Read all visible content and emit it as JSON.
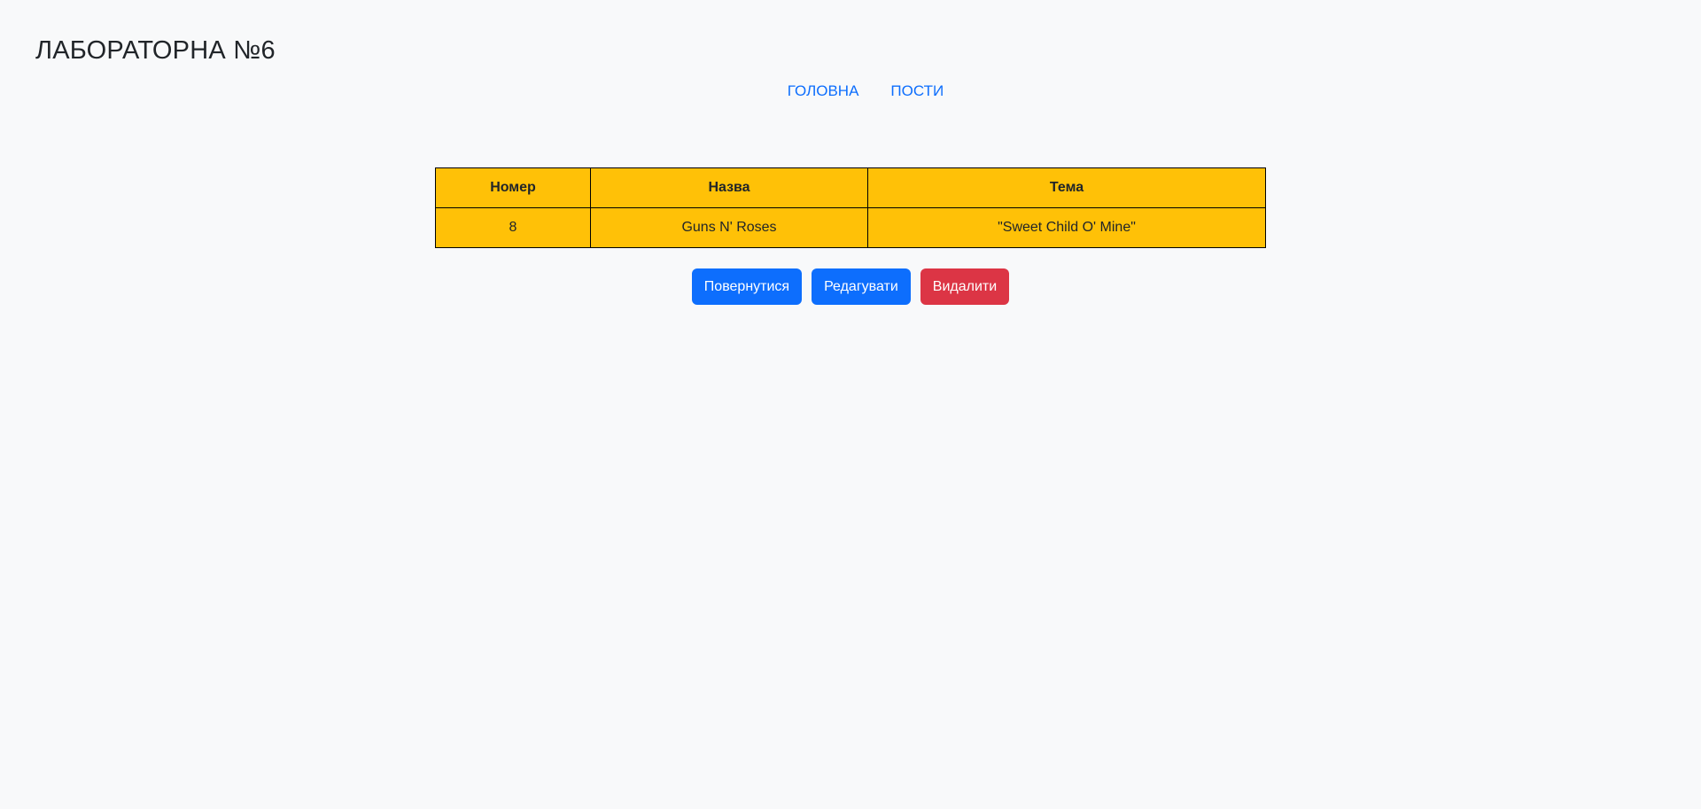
{
  "header": {
    "title": "ЛАБОРАТОРНА №6"
  },
  "nav": {
    "items": [
      {
        "label": "ГОЛОВНА"
      },
      {
        "label": "ПОСТИ"
      }
    ]
  },
  "table": {
    "columns": [
      "Номер",
      "Назва",
      "Тема"
    ],
    "rows": [
      [
        "8",
        "Guns N' Roses",
        "\"Sweet Child O' Mine\""
      ]
    ],
    "background_color": "#ffc107"
  },
  "actions": {
    "back_label": "Повернутися",
    "edit_label": "Редагувати",
    "delete_label": "Видалити",
    "primary_color": "#0d6efd",
    "danger_color": "#dc3545"
  }
}
